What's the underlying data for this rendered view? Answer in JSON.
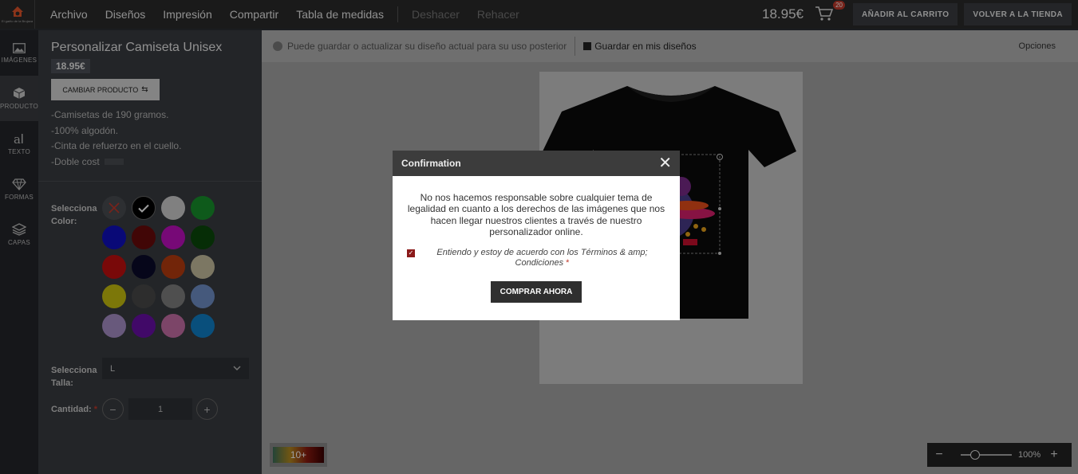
{
  "logo": {
    "text": "El garito de la Brujaca"
  },
  "menu": {
    "items": [
      "Archivo",
      "Diseños",
      "Impresión",
      "Compartir",
      "Tabla de medidas"
    ],
    "undo": "Deshacer",
    "redo": "Rehacer"
  },
  "header": {
    "price": "18.95€",
    "cart_count": "20",
    "add_to_cart": "AÑADIR AL CARRITO",
    "back_to_store": "VOLVER A LA TIENDA"
  },
  "iconbar": {
    "items": [
      {
        "label": "IMÁGENES",
        "icon": "image-icon"
      },
      {
        "label": "PRODUCTO",
        "icon": "cube-icon"
      },
      {
        "label": "TEXTO",
        "icon": "text-icon"
      },
      {
        "label": "FORMAS",
        "icon": "diamond-icon"
      },
      {
        "label": "CAPAS",
        "icon": "layers-icon"
      }
    ]
  },
  "product": {
    "title": "Personalizar Camiseta Unisex",
    "price": "18.95€",
    "change_label": "CAMBIAR PRODUCTO",
    "description": [
      "-Camisetas de 190 gramos.",
      "-100% algodón.",
      "-Cinta de refuerzo en el cuello.",
      "-Doble cost"
    ],
    "color_label": "Selecciona Color:",
    "colors": [
      "none",
      "#000000",
      "#cfcfcf",
      "#18922c",
      "#1010c0",
      "#6a0a0a",
      "#c010c0",
      "#0a4a0a",
      "#c41010",
      "#0a0a2a",
      "#b83c10",
      "#c8c0a0",
      "#c8c010",
      "#4a4a4a",
      "#808080",
      "#7090c8",
      "#a890c8",
      "#6a10a8",
      "#c870a8",
      "#1080c8"
    ],
    "selected_color": "#000000",
    "size_label": "Selecciona Talla:",
    "size_value": "L",
    "qty_label": "Cantidad:",
    "qty_required": "*",
    "qty_value": "1"
  },
  "toolbar": {
    "info": "Puede guardar o actualizar su diseño actual para su uso posterior",
    "save": "Guardar en mis diseños",
    "options": "Opciones"
  },
  "canvas": {
    "layers_badge": "10+",
    "zoom": "100%"
  },
  "modal": {
    "title": "Confirmation",
    "message": "No nos hacemos responsable sobre cualquier tema de legalidad en cuanto a los derechos de las imágenes que nos hacen llegar nuestros clientes a través de nuestro personalizador online.",
    "agree": "Entiendo y estoy de acuerdo con los Términos & amp; Condiciones",
    "required": "*",
    "buy": "COMPRAR AHORA"
  }
}
